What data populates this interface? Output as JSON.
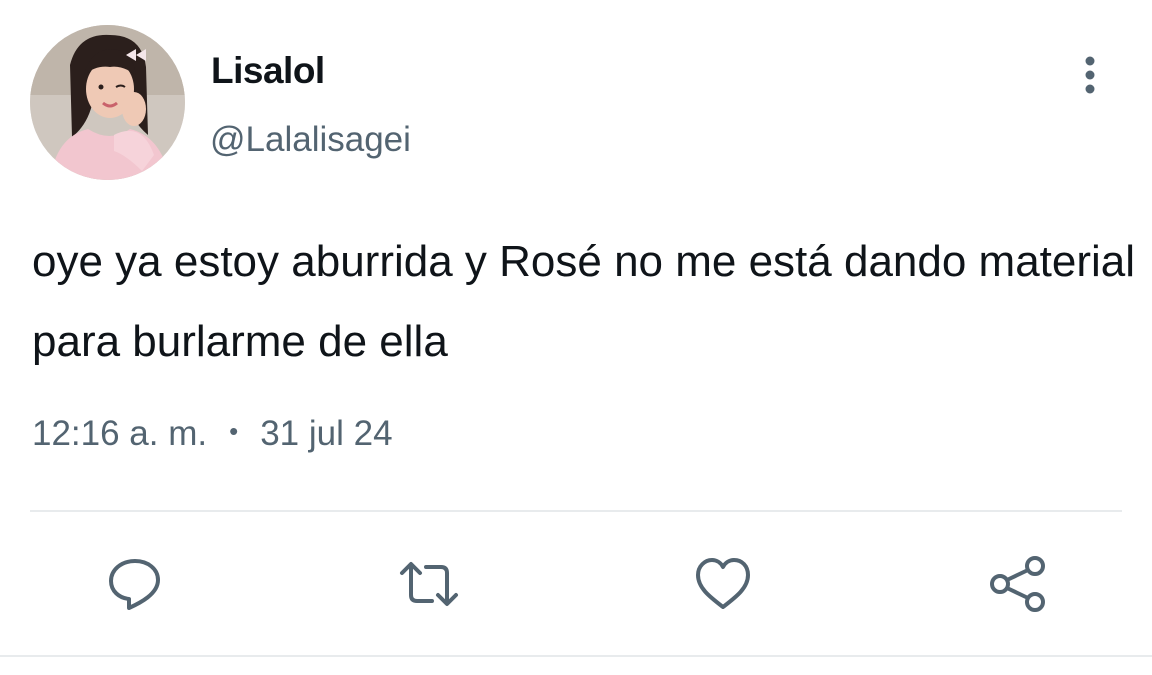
{
  "tweet": {
    "display_name": "Lisalol",
    "handle": "@Lalalisagei",
    "text": "oye ya estoy aburrida y Rosé no me está dando material para burlarme de ella",
    "time": "12:16 a. m.",
    "separator": "•",
    "date": "31 jul 24"
  },
  "icons": {
    "more": "more-vertical-icon",
    "reply": "reply-icon",
    "retweet": "retweet-icon",
    "like": "heart-icon",
    "share": "share-icon"
  },
  "colors": {
    "text_primary": "#0f1419",
    "text_secondary": "#536471",
    "icon": "#536471",
    "divider": "#e8ebed"
  }
}
